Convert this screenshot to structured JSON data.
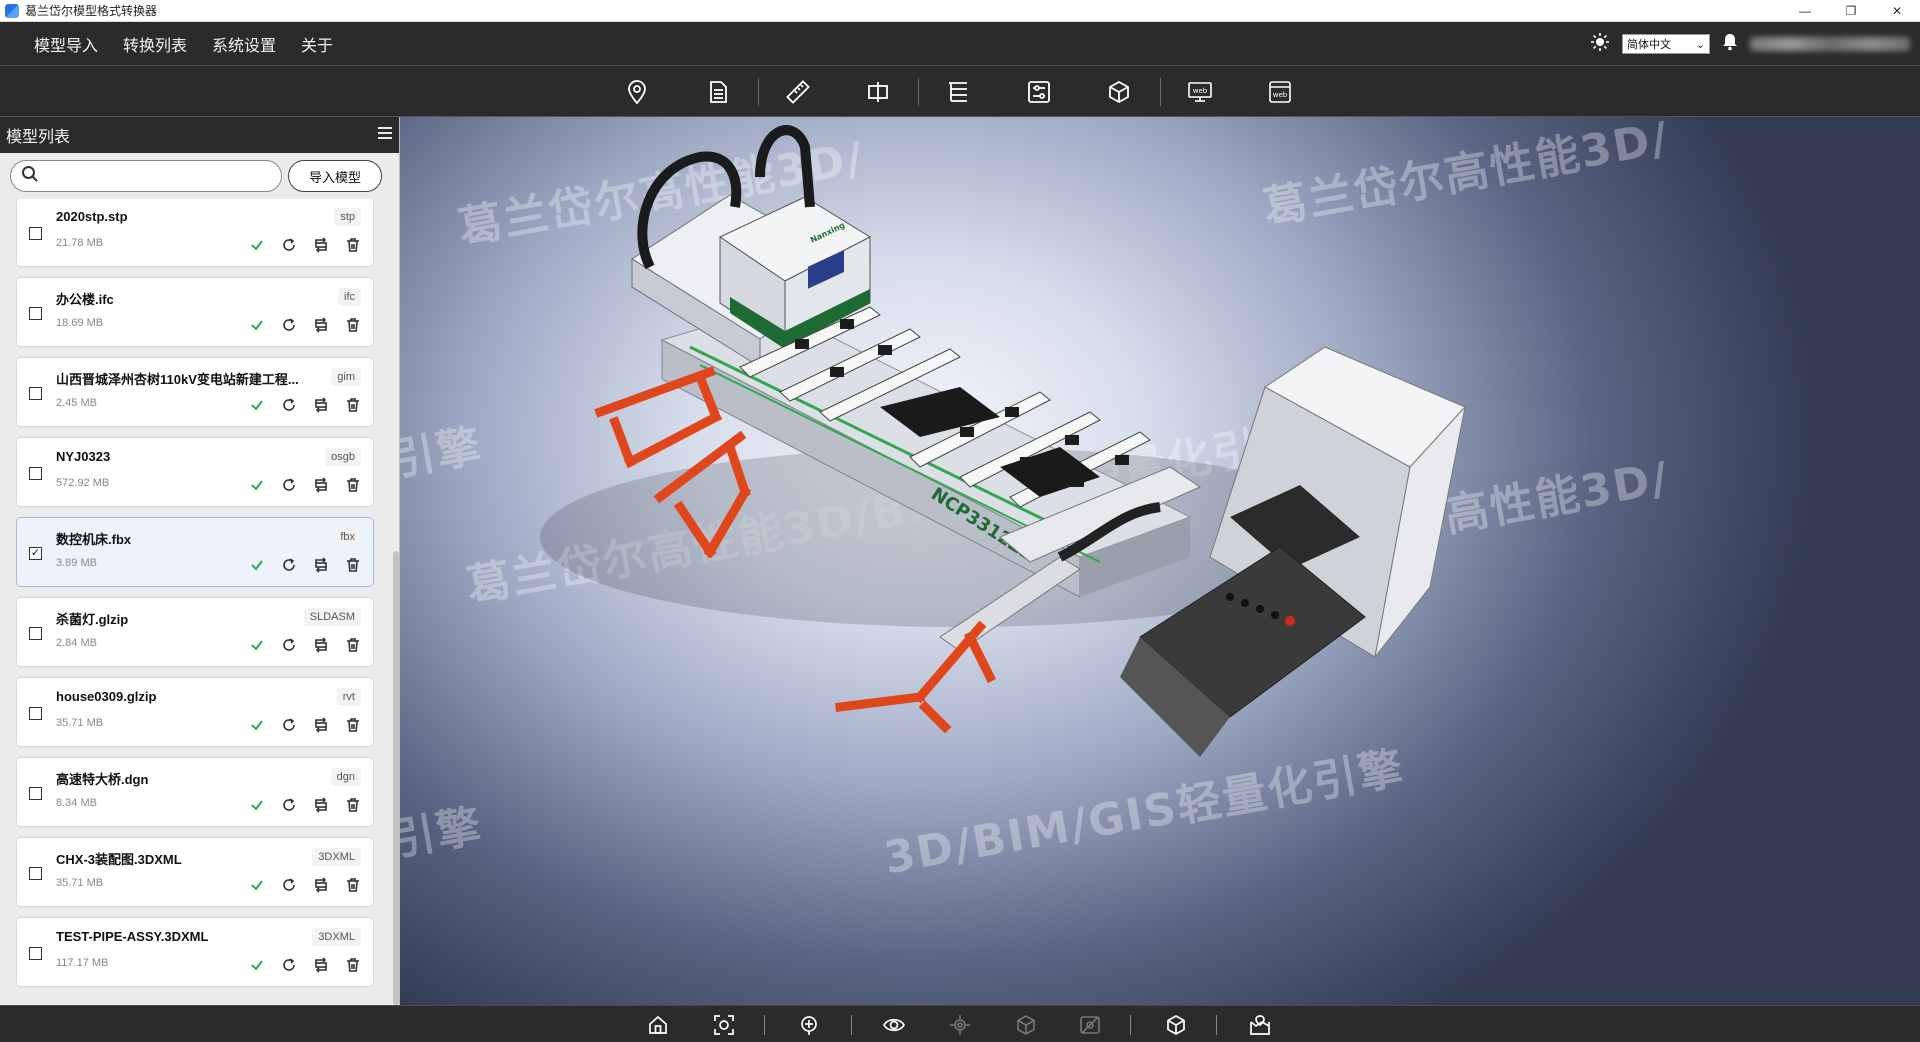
{
  "window": {
    "title": "葛兰岱尔模型格式转换器",
    "controls": [
      "—",
      "❐",
      "✕"
    ]
  },
  "menu": {
    "items": [
      "模型导入",
      "转换列表",
      "系统设置",
      "关于"
    ],
    "language": "简体中文"
  },
  "panel": {
    "title": "模型列表",
    "search_placeholder": "",
    "import_label": "导入模型"
  },
  "files": [
    {
      "name": "2020stp.stp",
      "size": "21.78 MB",
      "type": "stp",
      "checked": false
    },
    {
      "name": "办公楼.ifc",
      "size": "18.69 MB",
      "type": "ifc",
      "checked": false
    },
    {
      "name": "山西晋城泽州杏树110kV变电站新建工程...",
      "size": "2.45 MB",
      "type": "gim",
      "checked": false
    },
    {
      "name": "NYJ0323",
      "size": "572.92 MB",
      "type": "osgb",
      "checked": false
    },
    {
      "name": "数控机床.fbx",
      "size": "3.89 MB",
      "type": "fbx",
      "checked": true
    },
    {
      "name": "杀菌灯.glzip",
      "size": "2.84 MB",
      "type": "SLDASM",
      "checked": false
    },
    {
      "name": "house0309.glzip",
      "size": "35.71 MB",
      "type": "rvt",
      "checked": false
    },
    {
      "name": "高速特大桥.dgn",
      "size": "8.34 MB",
      "type": "dgn",
      "checked": false
    },
    {
      "name": "CHX-3装配图.3DXML",
      "size": "35.71 MB",
      "type": "3DXML",
      "checked": false
    },
    {
      "name": "TEST-PIPE-ASSY.3DXML",
      "size": "117.17 MB",
      "type": "3DXML",
      "checked": false
    }
  ],
  "viewport": {
    "watermarks": [
      "葛兰岱尔高性能3D/",
      "葛兰岱尔高性能3D/",
      "引擎",
      "葛兰岱尔高性能3D/BIM/GIS轻量化引擎",
      "葛兰岱尔高性能3D/",
      "引擎",
      "3D/BIM/GIS轻量化引擎"
    ],
    "machine_label_side": "NCP3312Z2",
    "machine_label_head": "Nanxing"
  },
  "toolbar_icons": [
    "location-icon",
    "document-icon",
    "measure-icon",
    "section-icon",
    "tree-icon",
    "settings-icon",
    "model-export-icon",
    "web-screen-icon",
    "web-window-icon"
  ],
  "bottom_icons": [
    "home-icon",
    "fit-view-icon",
    "add-point-icon",
    "view-icon",
    "explode-icon",
    "wireframe-icon",
    "hide-icon",
    "cube-view-icon",
    "map-icon"
  ],
  "colors": {
    "accent_green": "#2fa84f",
    "selected_bg": "#eef2fb",
    "dark_bar": "#2b2b2b"
  }
}
